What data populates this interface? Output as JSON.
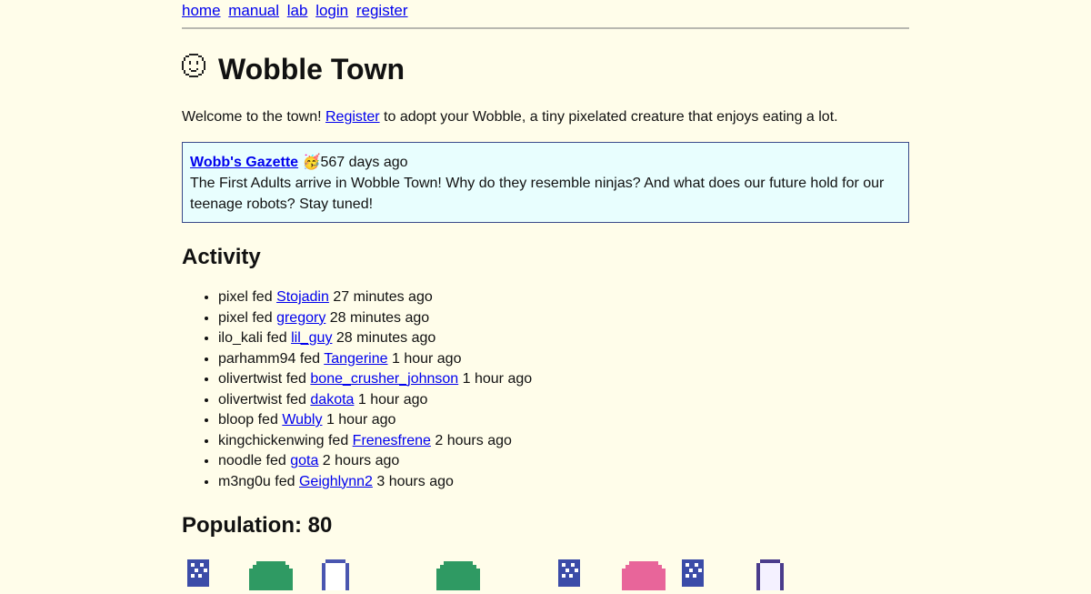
{
  "nav": {
    "items": [
      {
        "label": "home"
      },
      {
        "label": "manual"
      },
      {
        "label": "lab"
      },
      {
        "label": "login"
      },
      {
        "label": "register"
      }
    ]
  },
  "header": {
    "icon": "pixel-face-icon",
    "title": "Wobble Town"
  },
  "welcome": {
    "before": "Welcome to the town! ",
    "link": "Register",
    "after": " to adopt your Wobble, a tiny pixelated creature that enjoys eating a lot."
  },
  "gazette": {
    "title": "Wobb's Gazette",
    "emoji": "🥳",
    "age": "567 days ago",
    "body": "The First Adults arrive in Wobble Town! Why do they resemble ninjas? And what does our future hold for our teenage robots? Stay tuned!"
  },
  "activity": {
    "title": "Activity",
    "feeder_joiner": "fed",
    "items": [
      {
        "feeder": "pixel",
        "wobble": "Stojadin",
        "time": "27 minutes ago"
      },
      {
        "feeder": "pixel",
        "wobble": "gregory",
        "time": "28 minutes ago"
      },
      {
        "feeder": "ilo_kali",
        "wobble": "lil_guy",
        "time": "28 minutes ago"
      },
      {
        "feeder": "parhamm94",
        "wobble": "Tangerine",
        "time": "1 hour ago"
      },
      {
        "feeder": "olivertwist",
        "wobble": "bone_crusher_johnson",
        "time": "1 hour ago"
      },
      {
        "feeder": "olivertwist",
        "wobble": "dakota",
        "time": "1 hour ago"
      },
      {
        "feeder": "bloop",
        "wobble": "Wubly",
        "time": "1 hour ago"
      },
      {
        "feeder": "kingchickenwing",
        "wobble": "Frenesfrene",
        "time": "2 hours ago"
      },
      {
        "feeder": "noodle",
        "wobble": "gota",
        "time": "2 hours ago"
      },
      {
        "feeder": "m3ng0u",
        "wobble": "Geighlynn2",
        "time": "3 hours ago"
      }
    ]
  },
  "population": {
    "title": "Population: 80",
    "colors": {
      "robot": "#3b4ca8",
      "green": "#2f9a63",
      "ghost": "#4a56b0",
      "pink": "#e8659a",
      "ninja": "#4a3c8c"
    },
    "visible_wobbles": [
      {
        "kind": "robot",
        "icon": "robot-wobble-icon"
      },
      {
        "kind": "green",
        "icon": "green-blob-wobble-icon"
      },
      {
        "kind": "ghost",
        "icon": "ghost-wobble-icon"
      },
      {
        "kind": "green",
        "icon": "green-blob-wobble-icon"
      },
      {
        "kind": "robot",
        "icon": "robot-wobble-icon"
      },
      {
        "kind": "pink",
        "icon": "pink-blob-wobble-icon"
      },
      {
        "kind": "robot",
        "icon": "robot-wobble-icon"
      },
      {
        "kind": "ninja",
        "icon": "ninja-wobble-icon"
      }
    ]
  }
}
